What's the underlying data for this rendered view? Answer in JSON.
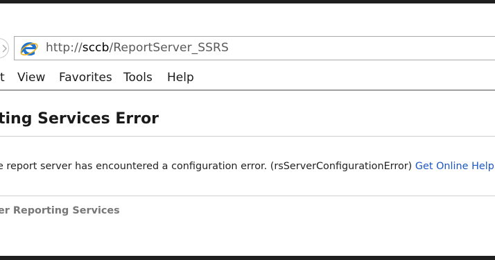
{
  "browser": {
    "url_prefix": "http://",
    "url_host": "sccb",
    "url_path": "/ReportServer_SSRS"
  },
  "menu": [
    "t",
    "View",
    "Favorites",
    "Tools",
    "Help"
  ],
  "page": {
    "title": "ting Services Error",
    "error_message": "e report server has encountered a configuration error. (rsServerConfigurationError)",
    "help_link": "Get Online Help",
    "footer": "er Reporting Services"
  },
  "colors": {
    "link": "#1a56c8",
    "ie_logo": "#1e73cf",
    "background": "#1f1f1f"
  }
}
